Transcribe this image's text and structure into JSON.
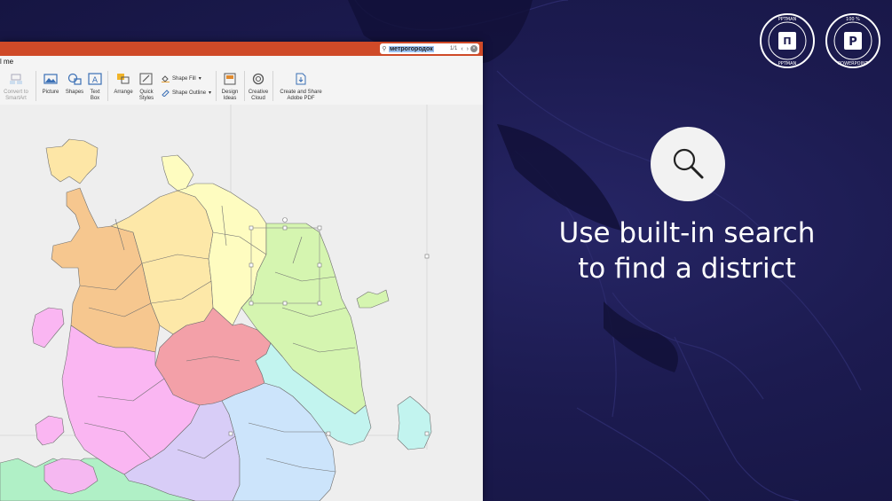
{
  "promo": {
    "headline_line1": "Use built-in search",
    "headline_line2": "to find a district",
    "icon": "magnifier-icon"
  },
  "badges": [
    {
      "text": "PPTMAN · COM · PPTMAN · COM ·",
      "icon": "pptman-logo-icon"
    },
    {
      "text": "EDITABLE · 100 % · POWERPOINT ·",
      "icon": "powerpoint-p-icon"
    }
  ],
  "app": {
    "menu_fragment": "l me",
    "search": {
      "value": "метрогородок",
      "count": "1/1"
    },
    "ribbon": {
      "convert": "Convert to\nSmartArt",
      "picture": "Picture",
      "shapes": "Shapes",
      "textbox": "Text\nBox",
      "arrange": "Arrange",
      "quick_styles": "Quick\nStyles",
      "shape_fill": "Shape Fill",
      "shape_outline": "Shape Outline",
      "design_ideas": "Design\nIdeas",
      "creative_cloud": "Creative\nCloud",
      "create_pdf": "Create and Share\nAdobe PDF"
    },
    "colors": {
      "titlebar": "#cf4a28",
      "selection": "#9bc2f2"
    }
  },
  "map": {
    "district_colors": {
      "north": "#fde8a8",
      "northwest": "#f6c78f",
      "northeast": "#fefcc0",
      "east": "#d5f5b0",
      "central": "#f3a0a8",
      "west": "#fab6f2",
      "southwest": "#d8cdf7",
      "south": "#cce4fb",
      "southeast": "#c2f4ef",
      "new": "#b0f0c6",
      "zelenograd": "#fde6a6",
      "other": "#f5b8f1"
    }
  }
}
